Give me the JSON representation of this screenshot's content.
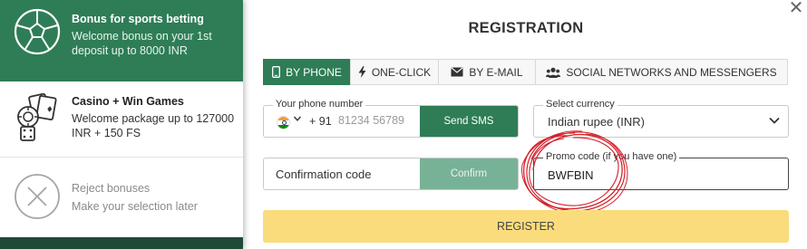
{
  "bonuses": {
    "sports": {
      "title": "Bonus for sports betting",
      "description": "Welcome bonus on your 1st deposit up to 8000 INR",
      "icon": "soccer-ball-icon"
    },
    "casino": {
      "title": "Casino + Win Games",
      "description": "Welcome package up to 127000 INR + 150 FS",
      "icon": "casino-chips-dice-icon"
    },
    "reject": {
      "title": "Reject bonuses",
      "description": "Make your selection later",
      "icon": "close-circle-icon"
    }
  },
  "form": {
    "title": "REGISTRATION",
    "tabs": [
      {
        "label": "BY PHONE",
        "icon": "phone-icon",
        "active": true
      },
      {
        "label": "ONE-CLICK",
        "icon": "lightning-icon",
        "active": false
      },
      {
        "label": "BY E-MAIL",
        "icon": "envelope-icon",
        "active": false
      },
      {
        "label": "SOCIAL NETWORKS AND MESSENGERS",
        "icon": "users-icon",
        "active": false
      }
    ],
    "phone": {
      "label": "Your phone number",
      "country_flag": "india-flag-icon",
      "dial_code": "+ 91",
      "placeholder": "81234 56789",
      "send_sms_label": "Send SMS"
    },
    "currency": {
      "label": "Select currency",
      "value": "Indian rupee (INR)"
    },
    "confirmation": {
      "placeholder": "Confirmation code",
      "button_label": "Confirm"
    },
    "promo": {
      "label": "Promo code (if you have one)",
      "value": "BWFBIN"
    },
    "register_label": "REGISTER",
    "close_icon": "close-icon"
  },
  "colors": {
    "brand_green": "#2e7d57",
    "confirm_disabled_green": "#78b296",
    "register_yellow": "#fbdc7c",
    "annotation_red": "#d4202a"
  }
}
